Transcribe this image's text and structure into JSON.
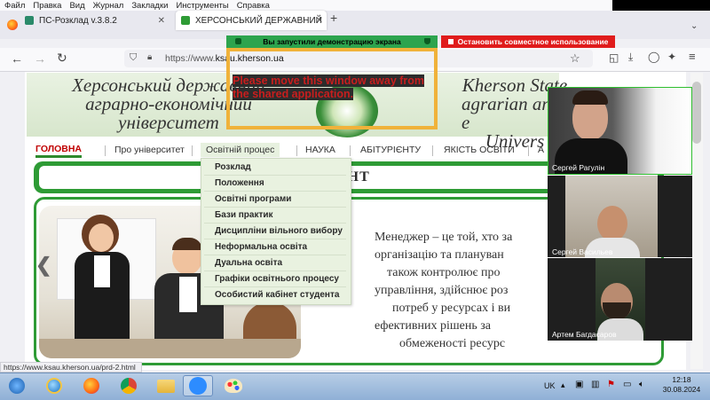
{
  "menubar": {
    "items": [
      "Файл",
      "Правка",
      "Вид",
      "Журнал",
      "Закладки",
      "Инструменты",
      "Справка"
    ]
  },
  "tabs": [
    {
      "title": "ПС-Розклад v.3.8.2"
    },
    {
      "title": "ХЕРСОНСЬКИЙ ДЕРЖАВНИЙ"
    }
  ],
  "share": {
    "running": "Вы запустили демонстрацию экрана",
    "stop": "Остановить совместное использование"
  },
  "url": {
    "prefix": "https://www.",
    "domain": "ksau.kherson.ua"
  },
  "warning": "Please move this window away from the shared application.",
  "header": {
    "ua": [
      "Херсонський державний",
      "аграрно-економічний",
      "університет"
    ],
    "en": [
      "Kherson State",
      "agrarian and e",
      "Univers"
    ]
  },
  "nav": [
    "ГОЛОВНА",
    "Про університет",
    "Освітній процес",
    "НАУКА",
    "АБІТУРІЄНТУ",
    "ЯКІСТЬ ОСВІТИ",
    "А"
  ],
  "dropdown": [
    "Розклад",
    "Положення",
    "Освітні програми",
    "Бази практик",
    "Дисципліни вільного вибору",
    "Неформальна освіта",
    "Дуальна освіта",
    "Графіки освітнього процесу",
    "Особистий кабінет студента"
  ],
  "banner_title": "ЕНТ",
  "body_lines": [
    "Менеджер – це той, хто за",
    "організацію та плануван",
    "також контролює про",
    "управління, здійснює роз",
    "потреб у ресурсах і ви",
    "ефективних рішень за",
    "обмеженості ресурс"
  ],
  "participants": [
    "Сергей Рагулін",
    "Сергей Васильев",
    "Артем Багдасаров"
  ],
  "status_url": "https://www.ksau.kherson.ua/prd-2.html",
  "tray": {
    "lang": "UK",
    "time": "12:18",
    "date": "30.08.2024"
  },
  "colors": {
    "accent_green": "#2e9b35",
    "share_green": "#2da44e",
    "stop_red": "#e01c1c",
    "warn_orange": "#f0b23a"
  },
  "icons": [
    "firefox-icon",
    "windows-start-icon",
    "ie-icon",
    "chrome-icon",
    "folder-icon",
    "zoom-icon",
    "paint-icon"
  ]
}
